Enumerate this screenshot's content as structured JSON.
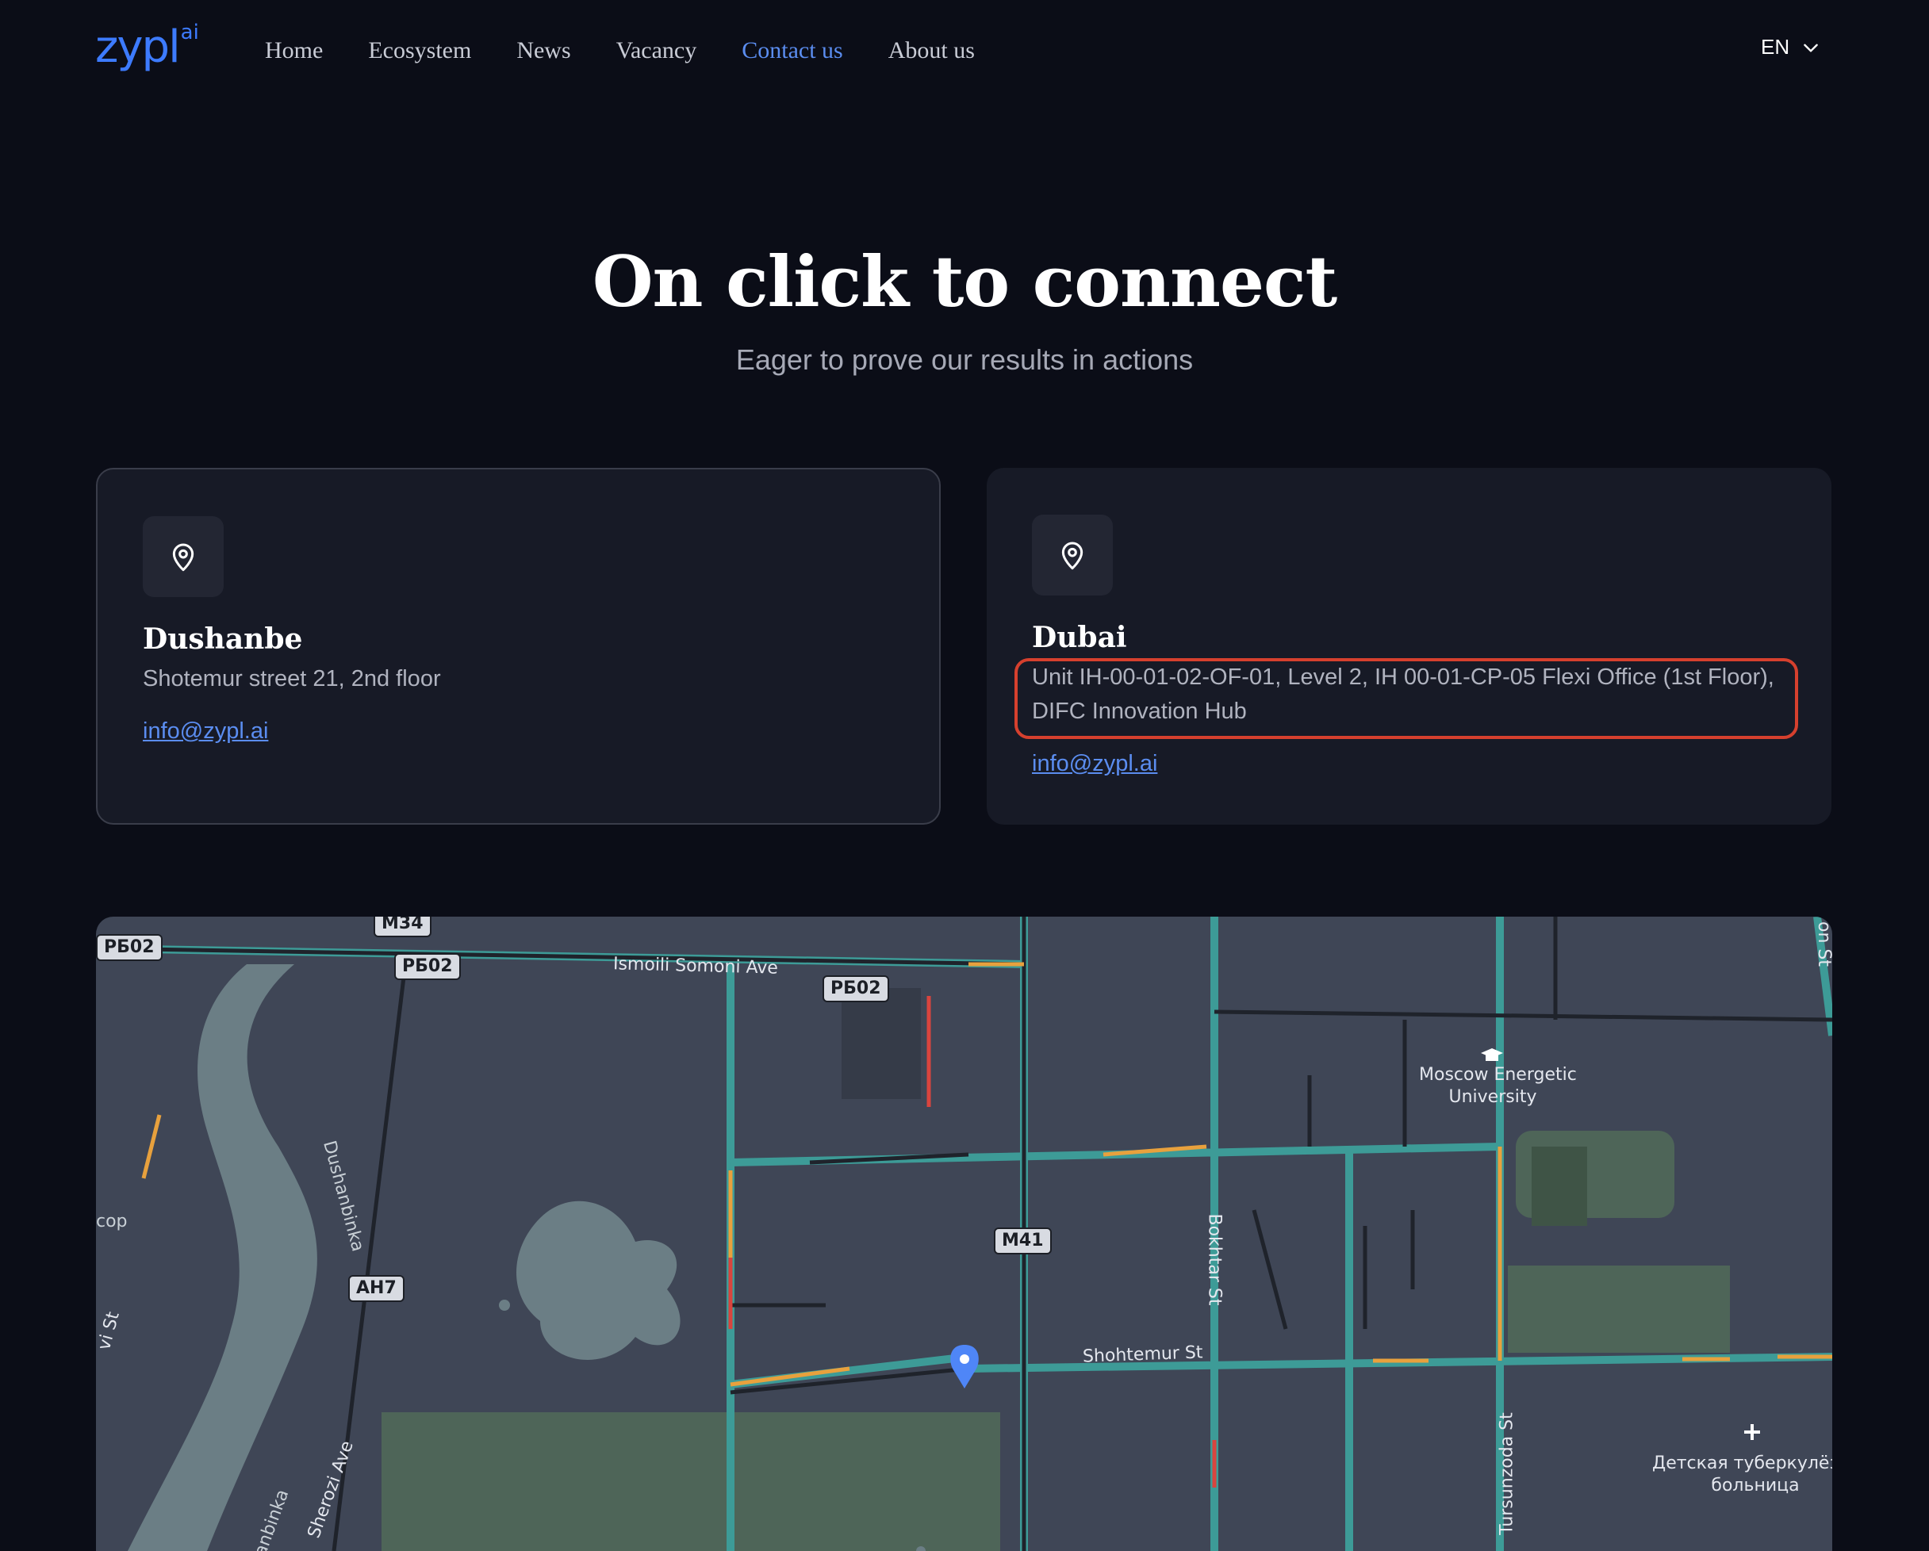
{
  "nav": {
    "logo_text": "zypl",
    "logo_sup": "ai",
    "links": [
      "Home",
      "Ecosystem",
      "News",
      "Vacancy",
      "Contact us",
      "About us"
    ],
    "active_link": "Contact us",
    "language": "EN"
  },
  "hero": {
    "title": "On click to connect",
    "subtitle": "Eager to prove our results in actions"
  },
  "offices": [
    {
      "city": "Dushanbe",
      "address": "Shotemur street 21, 2nd floor",
      "email": "info@zypl.ai",
      "icon": "location-pin-icon"
    },
    {
      "city": "Dubai",
      "address": "Unit IH-00-01-02-OF-01, Level 2, IH 00-01-CP-05 Flexi Office (1st Floor), DIFC Innovation Hub",
      "email": "info@zypl.ai",
      "icon": "location-pin-icon"
    }
  ],
  "map": {
    "road_badges": [
      "РБ02",
      "M34",
      "РБ02",
      "РБ02",
      "M41",
      "AH7"
    ],
    "street_labels": [
      "Ismoili Somoni Ave",
      "Shohtemur St",
      "Bokhtar St",
      "Tursunzoda St",
      "Dushanbinka",
      "Sherozi Ave",
      "vi St",
      "cop",
      "on St",
      "anbinka"
    ],
    "poi": [
      {
        "name_line1": "Moscow Energetic",
        "name_line2": "University"
      },
      {
        "name_line1": "Детская туберкулёзна",
        "name_line2": "больница"
      }
    ]
  },
  "colors": {
    "background": "#0b0d17",
    "card": "#171a26",
    "accent": "#5b8df0",
    "highlight": "#d6402e",
    "logo": "#3d7bff"
  }
}
